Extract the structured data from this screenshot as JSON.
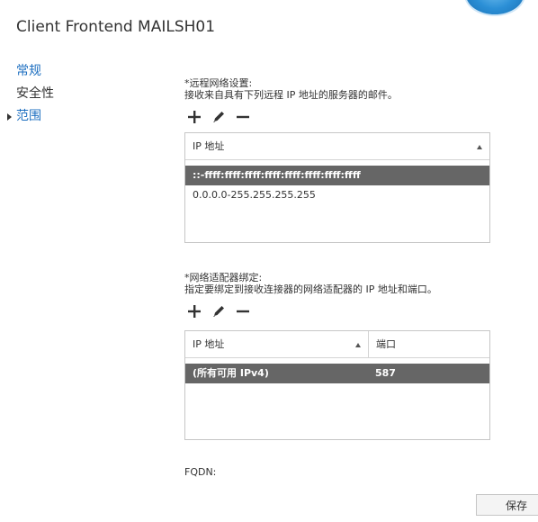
{
  "window": {
    "title": "Client Frontend MAILSH01"
  },
  "nav": {
    "items": [
      {
        "label": "常规"
      },
      {
        "label": "安全性"
      },
      {
        "label": "范围"
      }
    ]
  },
  "remote_network": {
    "label": "*远程网络设置:",
    "description": "接收来自具有下列远程 IP 地址的服务器的邮件。",
    "toolbar": {
      "add": "add-icon",
      "edit": "pencil-icon",
      "remove": "minus-icon"
    },
    "grid": {
      "header": "IP 地址",
      "rows": [
        "::-ffff:ffff:ffff:ffff:ffff:ffff:ffff:ffff",
        "0.0.0.0-255.255.255.255"
      ]
    }
  },
  "adapter_bindings": {
    "label": "*网络适配器绑定:",
    "description": "指定要绑定到接收连接器的网络适配器的 IP 地址和端口。",
    "toolbar": {
      "add": "add-icon",
      "edit": "pencil-icon",
      "remove": "minus-icon"
    },
    "grid": {
      "headers": [
        "IP 地址",
        "端口"
      ],
      "rows": [
        {
          "ip": "(所有可用 IPv4)",
          "port": "587"
        }
      ]
    }
  },
  "fqdn": {
    "label": "FQDN:"
  },
  "footer": {
    "save_label": "保存"
  },
  "colors": {
    "selected_row": "#666666",
    "nav_link": "#1e6fc0",
    "border": "#c6c6c6"
  }
}
